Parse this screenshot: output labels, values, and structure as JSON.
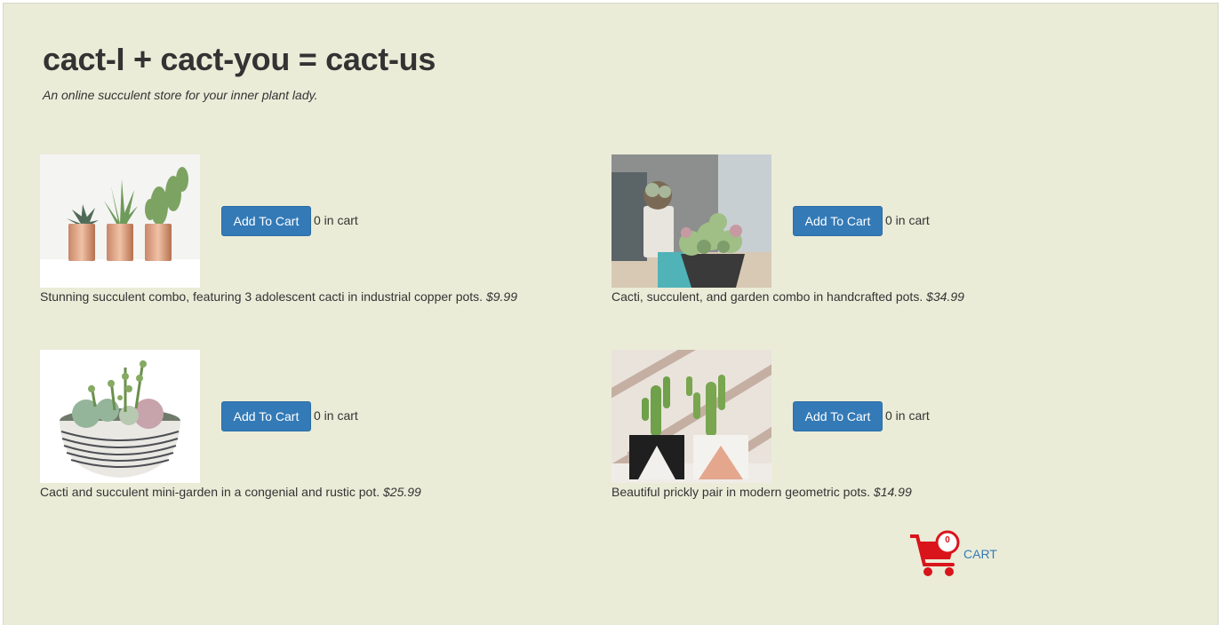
{
  "header": {
    "title": "cact-I + cact-you = cact-us",
    "tagline": "An online succulent store for your inner plant lady."
  },
  "products": [
    {
      "button_label": "Add To Cart",
      "cart_count": "0 in cart",
      "description": "Stunning succulent combo, featuring 3 adolescent cacti in industrial copper pots.",
      "price": "$9.99"
    },
    {
      "button_label": "Add To Cart",
      "cart_count": "0 in cart",
      "description": "Cacti, succulent, and garden combo in handcrafted pots.",
      "price": "$34.99"
    },
    {
      "button_label": "Add To Cart",
      "cart_count": "0 in cart",
      "description": "Cacti and succulent mini-garden in a congenial and rustic pot.",
      "price": "$25.99"
    },
    {
      "button_label": "Add To Cart",
      "cart_count": "0 in cart",
      "description": "Beautiful prickly pair in modern geometric pots.",
      "price": "$14.99"
    }
  ],
  "cart": {
    "label": "CART",
    "count": "0",
    "icon": "shopping-cart-icon"
  },
  "colors": {
    "page_background": "#ebecd8",
    "button": "#337ab7",
    "link": "#337ab7",
    "cart_icon": "#d9141b"
  }
}
